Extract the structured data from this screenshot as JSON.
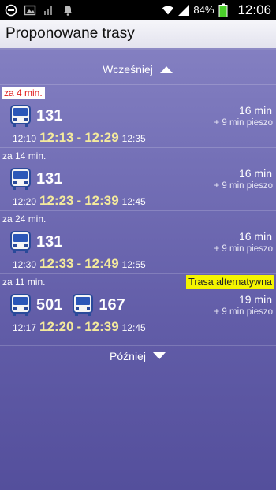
{
  "status_bar": {
    "left_icons": [
      "minus-circle-icon",
      "image-icon",
      "bars-icon",
      "bell-icon"
    ],
    "battery": "84%",
    "time": "12:06"
  },
  "title": "Proponowane trasy",
  "earlier_label": "Wcześniej",
  "later_label": "Później",
  "routes": [
    {
      "eta": "za 4 min.",
      "lines": [
        "131"
      ],
      "duration": "16 min",
      "walk": "+ 9 min pieszo",
      "start_walk": "12:10",
      "depart": "12:13",
      "arrive": "12:29",
      "end": "12:35"
    },
    {
      "eta": "za 14 min.",
      "lines": [
        "131"
      ],
      "duration": "16 min",
      "walk": "+ 9 min pieszo",
      "start_walk": "12:20",
      "depart": "12:23",
      "arrive": "12:39",
      "end": "12:45"
    },
    {
      "eta": "za 24 min.",
      "lines": [
        "131"
      ],
      "duration": "16 min",
      "walk": "+ 9 min pieszo",
      "start_walk": "12:30",
      "depart": "12:33",
      "arrive": "12:49",
      "end": "12:55"
    },
    {
      "eta": "za 11 min.",
      "badge": "Trasa alternatywna",
      "lines": [
        "501",
        "167"
      ],
      "duration": "19 min",
      "walk": "+ 9 min pieszo",
      "start_walk": "12:17",
      "depart": "12:20",
      "arrive": "12:39",
      "end": "12:45"
    }
  ],
  "colors": {
    "bg_top": "#8a86c6",
    "bg_bottom": "#544f9c",
    "time_highlight": "#f4ea9c",
    "alt_badge": "#f4f400",
    "eta_urgent": "#e02020"
  }
}
